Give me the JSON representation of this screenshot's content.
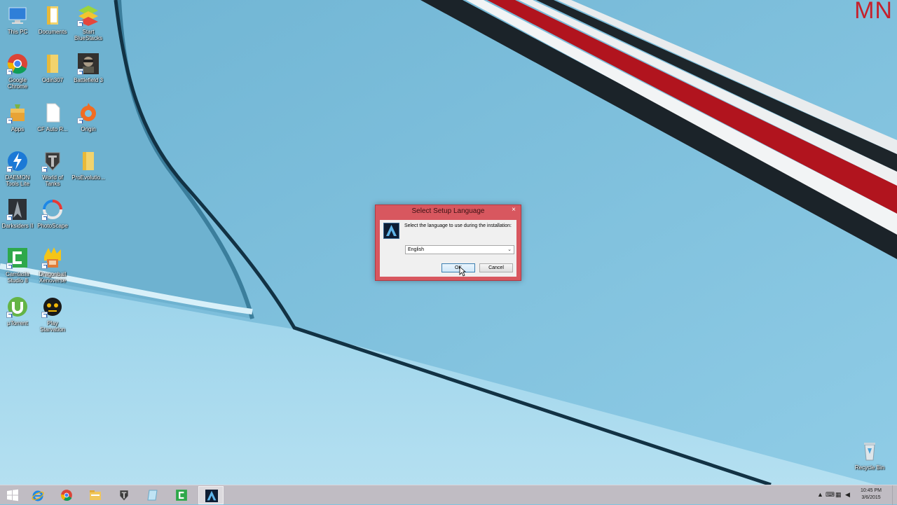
{
  "watermark": "MN",
  "desktop_icons": [
    {
      "label": "This PC",
      "icon": "this-pc-icon"
    },
    {
      "label": "Documents",
      "icon": "documents-folder-icon"
    },
    {
      "label": "Start BlueStacks",
      "icon": "bluestacks-icon"
    },
    {
      "label": "Google Chrome",
      "icon": "chrome-icon"
    },
    {
      "label": "Odin307",
      "icon": "folder-icon"
    },
    {
      "label": "Battlefield 3",
      "icon": "battlefield-icon"
    },
    {
      "label": "Apps",
      "icon": "apps-icon"
    },
    {
      "label": "CF Auto R...",
      "icon": "file-icon"
    },
    {
      "label": "Origin",
      "icon": "origin-icon"
    },
    {
      "label": "DAEMON Tools Lite",
      "icon": "daemon-tools-icon"
    },
    {
      "label": "World of Tanks",
      "icon": "world-of-tanks-icon"
    },
    {
      "label": "ProEvolutio...",
      "icon": "folder-icon"
    },
    {
      "label": "Darksiders II",
      "icon": "darksiders-icon"
    },
    {
      "label": "PhotoScape",
      "icon": "photoscape-icon"
    },
    {
      "label": "Camtasia Studio 8",
      "icon": "camtasia-icon"
    },
    {
      "label": "Dragonball Xenoverse",
      "icon": "dragonball-icon"
    },
    {
      "label": "µTorrent",
      "icon": "utorrent-icon"
    },
    {
      "label": "Play Starvation",
      "icon": "starvation-icon"
    },
    {
      "label": "Recycle Bin",
      "icon": "recycle-bin-icon"
    }
  ],
  "dialog": {
    "title": "Select Setup Language",
    "close": "×",
    "prompt": "Select the language to use during the installation:",
    "selected_language": "English",
    "ok_label": "OK",
    "cancel_label": "Cancel"
  },
  "taskbar": {
    "apps": [
      {
        "name": "internet-explorer"
      },
      {
        "name": "google-chrome"
      },
      {
        "name": "file-explorer"
      },
      {
        "name": "world-of-tanks"
      },
      {
        "name": "notepad"
      },
      {
        "name": "camtasia"
      },
      {
        "name": "setup",
        "active": true
      }
    ],
    "time": "10:45 PM",
    "date": "3/6/2015"
  },
  "colors": {
    "dialog_frame": "#d8575f",
    "taskbar": "#c0bcc3",
    "watermark": "#c6202b"
  }
}
